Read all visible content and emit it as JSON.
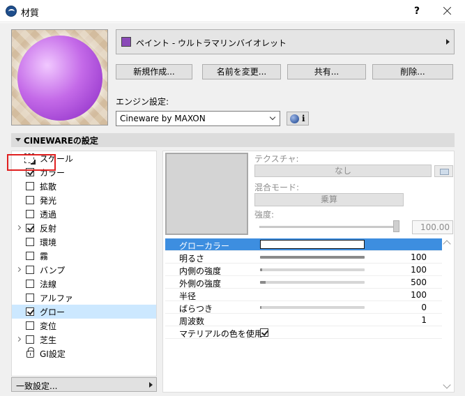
{
  "window": {
    "title": "材質",
    "help_label": "?"
  },
  "material": {
    "name": "ペイント - ウルトラマリンバイオレット",
    "swatch_color": "#8a4ab8"
  },
  "buttons": {
    "new": "新規作成...",
    "rename": "名前を変更...",
    "share": "共有...",
    "delete": "削除..."
  },
  "engine": {
    "label": "エンジン設定:",
    "value": "Cineware by MAXON",
    "info_label": "i"
  },
  "section": {
    "title": "CINEWAREの設定"
  },
  "channels": [
    {
      "label": "スケール"
    },
    {
      "label": "カラー"
    },
    {
      "label": "拡散"
    },
    {
      "label": "発光"
    },
    {
      "label": "透過"
    },
    {
      "label": "反射"
    },
    {
      "label": "環境"
    },
    {
      "label": "霧"
    },
    {
      "label": "バンプ"
    },
    {
      "label": "法線"
    },
    {
      "label": "アルファ"
    },
    {
      "label": "グロー"
    },
    {
      "label": "変位"
    },
    {
      "label": "芝生"
    },
    {
      "label": "GI設定"
    }
  ],
  "match_settings": {
    "label": "一致設定..."
  },
  "texture": {
    "label": "テクスチャ:",
    "value": "なし"
  },
  "blend": {
    "label": "混合モード:",
    "value": "乗算"
  },
  "intensity": {
    "label": "強度:",
    "value": "100.00"
  },
  "params": [
    {
      "label": "グローカラー"
    },
    {
      "label": "明るさ",
      "value": "100"
    },
    {
      "label": "内側の強度",
      "value": "100"
    },
    {
      "label": "外側の強度",
      "value": "500"
    },
    {
      "label": "半径",
      "value": "100"
    },
    {
      "label": "ばらつき",
      "value": "0"
    },
    {
      "label": "周波数",
      "value": "1"
    },
    {
      "label": "マテリアルの色を使用"
    }
  ],
  "colors": {
    "accent": "#3d8ee0",
    "selection": "#cce8ff",
    "highlight": "#e02020"
  }
}
